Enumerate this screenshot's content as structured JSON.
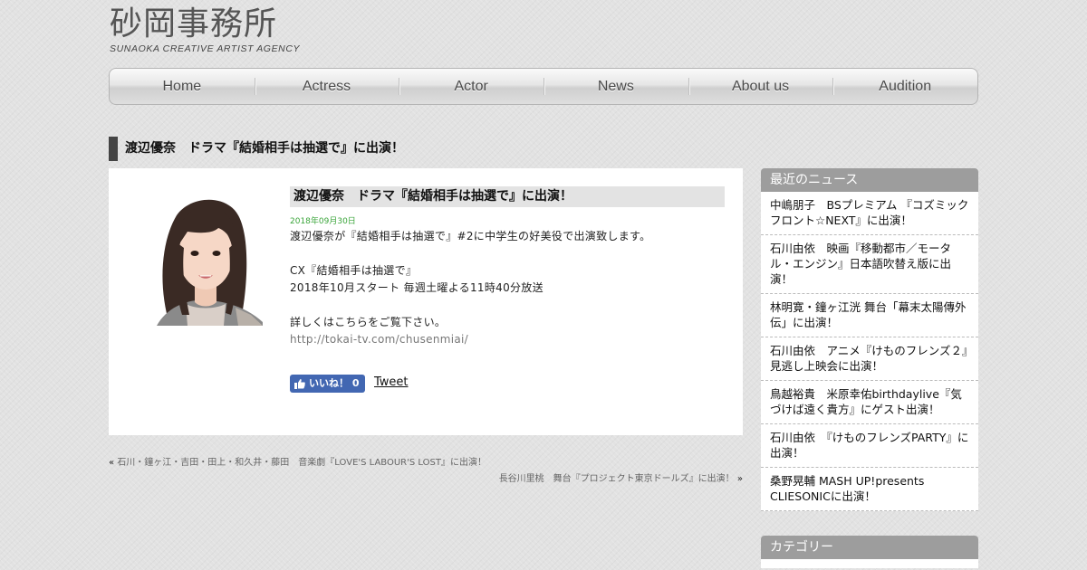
{
  "header": {
    "logo_title": "砂岡事務所",
    "logo_subtitle": "SUNAOKA CREATIVE ARTIST AGENCY"
  },
  "nav": {
    "items": [
      {
        "label": "Home"
      },
      {
        "label": "Actress"
      },
      {
        "label": "Actor"
      },
      {
        "label": "News"
      },
      {
        "label": "About us"
      },
      {
        "label": "Audition"
      }
    ]
  },
  "page": {
    "title": "渡辺優奈　ドラマ『結婚相手は抽選で』に出演！"
  },
  "article": {
    "heading": "渡辺優奈　ドラマ『結婚相手は抽選で』に出演！",
    "date": "2018年09月30日",
    "lines": [
      "渡辺優奈が『結婚相手は抽選で』#2に中学生の好美役で出演致します。",
      "CX『結婚相手は抽選で』",
      "2018年10月スタート 毎週土曜よる11時40分放送",
      "詳しくはこちらをご覧下さい。"
    ],
    "link": "http://tokai-tv.com/chusenmiai/",
    "like_label": "いいね！ 0",
    "tweet_label": "Tweet"
  },
  "post_nav": {
    "prev_arrow": "«",
    "prev_title": "石川・鐘ヶ江・吉田・田上・和久井・藤田　音楽劇『LOVE'S LABOUR'S LOST』に出演！",
    "next_title": "長谷川里桃　舞台『プロジェクト東京ドールズ』に出演！",
    "next_arrow": "»"
  },
  "sidebar": {
    "news_title": "最近のニュース",
    "news_items": [
      "中嶋朋子　BSプレミアム 『コズミックフロント☆NEXT』に出演！",
      "石川由依　映画『移動都市／モータル・エンジン』日本語吹替え版に出演！",
      "林明寛・鐘ヶ江洸 舞台「幕末太陽傳外伝」に出演！",
      "石川由依　アニメ『けものフレンズ２』見逃し上映会に出演！",
      "鳥越裕貴　米原幸佑birthdaylive『気づけば遠く貴方』にゲスト出演！",
      "石川由依　『けものフレンズPARTY』に出演！",
      "桑野晃輔 MASH UP!presents CLIESONICに出演！"
    ],
    "category_title": "カテゴリー"
  },
  "colors": {
    "nav_text": "#4a4a4a",
    "date_green": "#3aa53a",
    "facebook_blue": "#4267b2",
    "widget_header": "#9d9d9d"
  }
}
